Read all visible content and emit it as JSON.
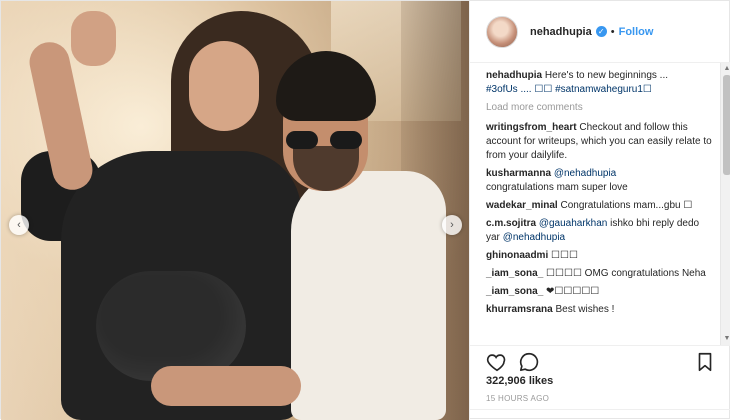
{
  "header": {
    "username": "nehadhupia",
    "verified_glyph": "✓",
    "separator": "•",
    "follow_label": "Follow"
  },
  "photo": {
    "prev_glyph": "‹",
    "next_glyph": "›"
  },
  "caption": {
    "username": "nehadhupia",
    "text": "Here's to new beginnings ...",
    "tags": "#3ofUs .... ☐☐ #satnamwaheguru1☐"
  },
  "load_more_label": "Load more comments",
  "comments": [
    {
      "user": "writingsfrom_heart",
      "text": "Checkout and follow this account for writeups, which you can easily relate to from your dailylife."
    },
    {
      "user": "kusharmanna",
      "mention": "@nehadhupia",
      "text": "congratulations mam super love"
    },
    {
      "user": "wadekar_minal",
      "text": "Congratulations mam...gbu ☐"
    },
    {
      "user": "c.m.sojitra",
      "mention": "@gauaharkhan",
      "text": "ishko bhi reply dedo yar",
      "mention2": "@nehadhupia"
    },
    {
      "user": "ghinonaadmi",
      "text": "☐☐☐"
    },
    {
      "user": "_iam_sona_",
      "text": "☐☐☐☐ OMG congratulations Neha"
    },
    {
      "user": "_iam_sona_",
      "text": "❤☐☐☐☐☐"
    },
    {
      "user": "khurramsrana",
      "text": "Best wishes !"
    }
  ],
  "scrollbar": {
    "up_glyph": "▲",
    "down_glyph": "▼"
  },
  "actions": {
    "like_icon": "heart-outline",
    "comment_icon": "speech-bubble",
    "save_icon": "bookmark"
  },
  "likes_text": "322,906 likes",
  "time_text": "15 HOURS AGO",
  "colors": {
    "link": "#3897f0",
    "mention": "#003569",
    "muted": "#999999",
    "text": "#262626"
  }
}
